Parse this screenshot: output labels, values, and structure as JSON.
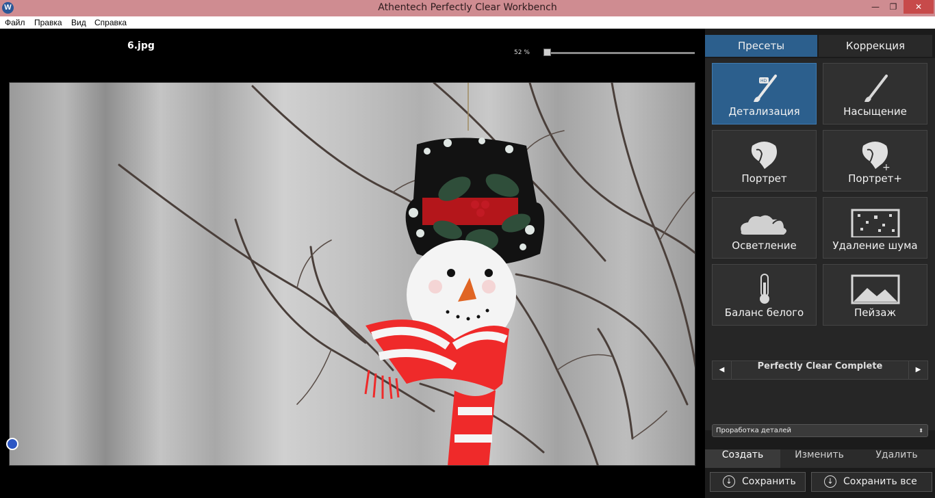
{
  "window": {
    "app_icon": "W",
    "title": "Athentech Perfectly Clear Workbench",
    "minimize_glyph": "—",
    "maximize_glyph": "❐",
    "close_glyph": "✕"
  },
  "menu": [
    "Файл",
    "Правка",
    "Вид",
    "Справка"
  ],
  "viewer": {
    "filename": "6.jpg",
    "zoom": "52 %",
    "zoom_percent": 52
  },
  "panel": {
    "tabs": [
      "Пресеты",
      "Коррекция"
    ],
    "active_tab": 0,
    "presets": [
      {
        "label": "Детализация",
        "icon": "brush-hd-icon",
        "active": true
      },
      {
        "label": "Насыщение",
        "icon": "brush-icon",
        "active": false
      },
      {
        "label": "Портрет",
        "icon": "portrait-icon",
        "active": false
      },
      {
        "label": "Портрет+",
        "icon": "portrait-plus-icon",
        "active": false
      },
      {
        "label": "Осветление",
        "icon": "cloud-icon",
        "active": false
      },
      {
        "label": "Удаление шума",
        "icon": "noise-icon",
        "active": false
      },
      {
        "label": "Баланс белого",
        "icon": "thermometer-icon",
        "active": false
      },
      {
        "label": "Пейзаж",
        "icon": "landscape-icon",
        "active": false
      }
    ],
    "profile": {
      "prev_glyph": "◀",
      "name": "Perfectly Clear Complete",
      "next_glyph": "▶"
    },
    "select_value": "Проработка деталей",
    "select_arrow": "⬍",
    "actions": [
      "Создать",
      "Изменить",
      "Удалить"
    ],
    "save": "Сохранить",
    "save_all": "Сохранить все",
    "save_glyph": "↓"
  },
  "colors": {
    "title_bar": "#cf8c91",
    "accent": "#2c5f8d",
    "panel_bg": "#1b1b1b"
  }
}
